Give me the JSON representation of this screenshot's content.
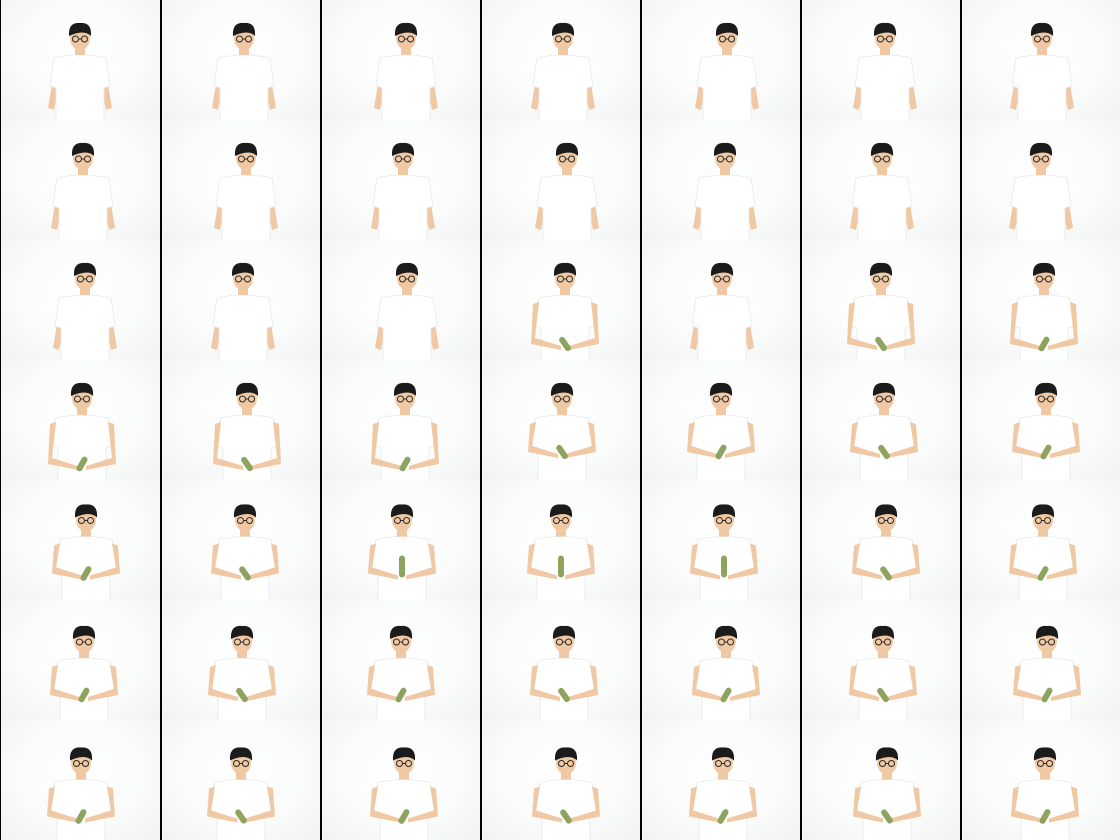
{
  "contact_sheet": {
    "rows": 7,
    "columns": 7,
    "background_color": "#f7f8f8",
    "separator_color": "#000000",
    "subject": {
      "hair_color": "#1b1b1b",
      "skin_color": "#f0c9a4",
      "shirt_color": "#ffffff",
      "glasses_color": "#2a2a2a",
      "prop_color": "#8da35e"
    },
    "frames": [
      {
        "prop": "none"
      },
      {
        "prop": "none"
      },
      {
        "prop": "none"
      },
      {
        "prop": "none"
      },
      {
        "prop": "none"
      },
      {
        "prop": "none"
      },
      {
        "prop": "none"
      },
      {
        "prop": "none"
      },
      {
        "prop": "none"
      },
      {
        "prop": "none"
      },
      {
        "prop": "none"
      },
      {
        "prop": "none"
      },
      {
        "prop": "none"
      },
      {
        "prop": "none"
      },
      {
        "prop": "none"
      },
      {
        "prop": "none"
      },
      {
        "prop": "none"
      },
      {
        "prop": "low"
      },
      {
        "prop": "none"
      },
      {
        "prop": "low"
      },
      {
        "prop": "low"
      },
      {
        "prop": "low"
      },
      {
        "prop": "low"
      },
      {
        "prop": "low"
      },
      {
        "prop": "chest"
      },
      {
        "prop": "chest"
      },
      {
        "prop": "chest"
      },
      {
        "prop": "chest"
      },
      {
        "prop": "chest"
      },
      {
        "prop": "chest"
      },
      {
        "prop": "upright"
      },
      {
        "prop": "upright"
      },
      {
        "prop": "upright"
      },
      {
        "prop": "chest"
      },
      {
        "prop": "chest"
      },
      {
        "prop": "chest"
      },
      {
        "prop": "chest"
      },
      {
        "prop": "chest"
      },
      {
        "prop": "chest"
      },
      {
        "prop": "chest"
      },
      {
        "prop": "chest"
      },
      {
        "prop": "chest"
      },
      {
        "prop": "chest"
      },
      {
        "prop": "chest"
      },
      {
        "prop": "chest"
      },
      {
        "prop": "chest"
      },
      {
        "prop": "chest"
      },
      {
        "prop": "chest"
      },
      {
        "prop": "chest"
      }
    ]
  }
}
